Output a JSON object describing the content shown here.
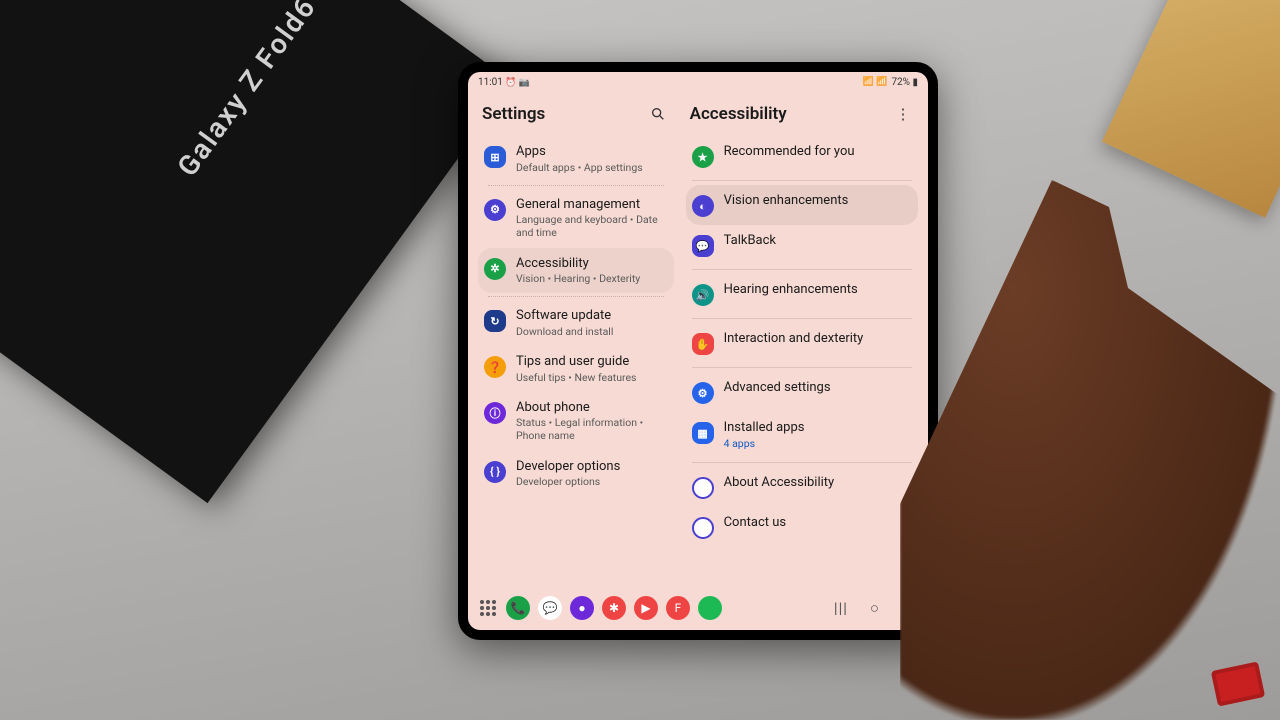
{
  "photo": {
    "box_text": "Galaxy Z Fold6"
  },
  "status": {
    "time": "11:01",
    "left_icons": "⏰ 📷",
    "right_icons": "📶 📶",
    "battery": "72% ▮"
  },
  "left": {
    "title": "Settings",
    "items": [
      {
        "icon": "⊞",
        "icon_class": "c-blue ic-sq",
        "title": "Apps",
        "sub": "Default apps  •  App settings"
      },
      {
        "icon": "⚙",
        "icon_class": "c-indigo",
        "title": "General management",
        "sub": "Language and keyboard  •  Date and time"
      },
      {
        "icon": "✲",
        "icon_class": "c-green",
        "title": "Accessibility",
        "sub": "Vision  •  Hearing  •  Dexterity",
        "selected": true
      },
      {
        "icon": "↻",
        "icon_class": "c-navy ic-sq",
        "title": "Software update",
        "sub": "Download and install"
      },
      {
        "icon": "❓",
        "icon_class": "c-orange",
        "title": "Tips and user guide",
        "sub": "Useful tips  •  New features"
      },
      {
        "icon": "ⓘ",
        "icon_class": "c-purple",
        "title": "About phone",
        "sub": "Status  •  Legal information  •  Phone name"
      },
      {
        "icon": "{ }",
        "icon_class": "c-indigo",
        "title": "Developer options",
        "sub": "Developer options"
      }
    ],
    "dividers_after": [
      0,
      2
    ]
  },
  "right": {
    "title": "Accessibility",
    "groups": [
      [
        {
          "icon": "★",
          "icon_class": "c-green",
          "title": "Recommended for you"
        }
      ],
      [
        {
          "icon": "◐",
          "icon_class": "c-indigo",
          "title": "Vision enhancements",
          "pressed": true
        },
        {
          "icon": "💬",
          "icon_class": "c-indigo ic-sq",
          "title": "TalkBack"
        }
      ],
      [
        {
          "icon": "🔊",
          "icon_class": "c-teal",
          "title": "Hearing enhancements"
        }
      ],
      [
        {
          "icon": "✋",
          "icon_class": "c-red ic-sq",
          "title": "Interaction and dexterity"
        }
      ],
      [
        {
          "icon": "⚙",
          "icon_class": "c-sblue",
          "title": "Advanced settings"
        },
        {
          "icon": "▦",
          "icon_class": "c-sblue ic-sq",
          "title": "Installed apps",
          "sub": "4 apps",
          "sub_accent": true
        }
      ],
      [
        {
          "icon": "◯",
          "icon_class": "c-ring",
          "title": "About Accessibility"
        },
        {
          "icon": "✉",
          "icon_class": "c-ring",
          "title": "Contact us"
        }
      ]
    ]
  },
  "dock": {
    "apps": [
      {
        "class": "c-green",
        "glyph": "📞"
      },
      {
        "class": "",
        "glyph": "💬",
        "style": "background:#fff;color:#2b5bd7;"
      },
      {
        "class": "c-purple",
        "glyph": "●"
      },
      {
        "class": "c-red",
        "glyph": "✱"
      },
      {
        "class": "c-red ic-sq",
        "glyph": "▶"
      },
      {
        "class": "c-red ic-sq",
        "glyph": "F"
      },
      {
        "class": "",
        "glyph": "",
        "style": "background:#1db954;"
      }
    ],
    "nav": {
      "recent": "|||",
      "home": "○",
      "back": "〈"
    }
  }
}
